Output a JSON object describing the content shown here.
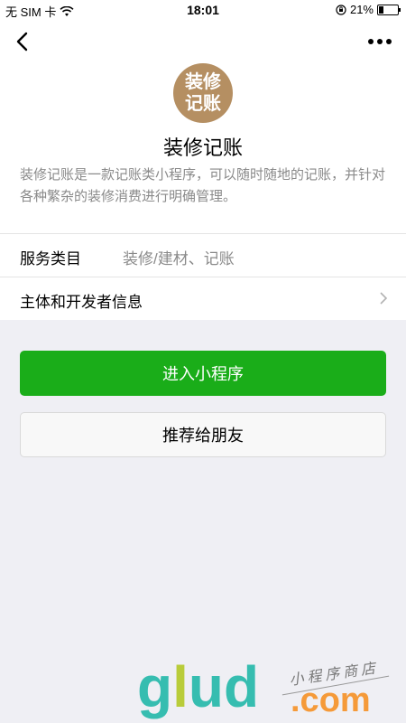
{
  "status_bar": {
    "carrier": "无 SIM 卡",
    "time": "18:01",
    "battery_text": "21%",
    "battery_level": 0.21
  },
  "app": {
    "logo_line1": "装修",
    "logo_line2": "记账",
    "name": "装修记账",
    "description": "装修记账是一款记账类小程序，可以随时随地的记账，并针对各种繁杂的装修消费进行明确管理。"
  },
  "info_rows": {
    "category_label": "服务类目",
    "category_value": "装修/建材、记账",
    "developer_label": "主体和开发者信息"
  },
  "buttons": {
    "enter": "进入小程序",
    "recommend": "推荐给朋友"
  },
  "watermark": {
    "brand_g": "g",
    "brand_l": "l",
    "brand_u": "u",
    "brand_d": "d",
    "tagline": "小程序商店",
    "domain": ".com"
  },
  "colors": {
    "primary_green": "#1aad19",
    "logo_brown": "#b58f62",
    "background": "#efeff4"
  }
}
